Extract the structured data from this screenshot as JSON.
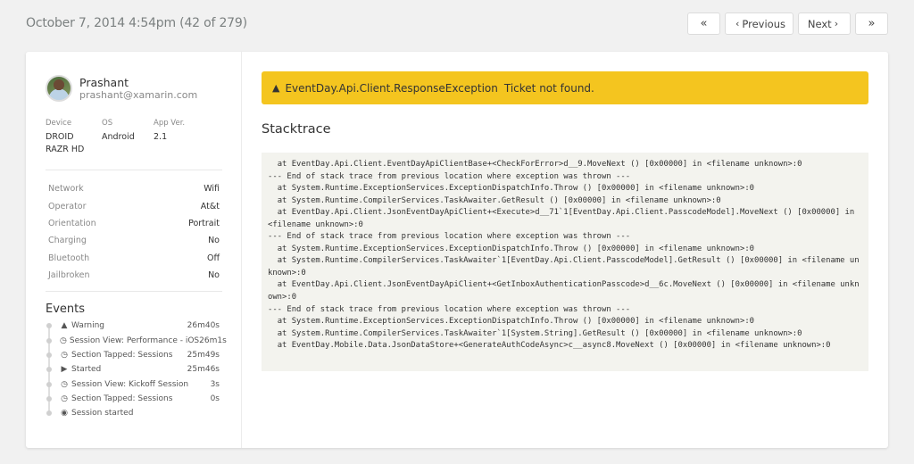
{
  "header": {
    "title": "October 7, 2014 4:54pm (42 of 279)"
  },
  "pager": {
    "first_icon": "«",
    "previous_label": "Previous",
    "previous_icon": "‹",
    "next_label": "Next",
    "next_icon": "›",
    "last_icon": "»"
  },
  "user": {
    "name": "Prashant",
    "email": "prashant@xamarin.com"
  },
  "device_meta": [
    {
      "label": "Device",
      "value": "DROID\nRAZR HD"
    },
    {
      "label": "OS",
      "value": "Android"
    },
    {
      "label": "App Ver.",
      "value": "2.1"
    }
  ],
  "properties": [
    {
      "key": "Network",
      "value": "Wifi"
    },
    {
      "key": "Operator",
      "value": "At&t"
    },
    {
      "key": "Orientation",
      "value": "Portrait"
    },
    {
      "key": "Charging",
      "value": "No"
    },
    {
      "key": "Bluetooth",
      "value": "Off"
    },
    {
      "key": "Jailbroken",
      "value": "No"
    }
  ],
  "events": {
    "title": "Events",
    "items": [
      {
        "icon": "warning-icon",
        "glyph": "▲",
        "label": "Warning",
        "time": "26m40s"
      },
      {
        "icon": "clock-icon",
        "glyph": "◷",
        "label": "Session View: Performance - iOS",
        "time": "26m1s"
      },
      {
        "icon": "clock-icon",
        "glyph": "◷",
        "label": "Section Tapped: Sessions",
        "time": "25m49s"
      },
      {
        "icon": "play-icon",
        "glyph": "▶",
        "label": "Started",
        "time": "25m46s"
      },
      {
        "icon": "clock-icon",
        "glyph": "◷",
        "label": "Session View: Kickoff Session",
        "time": "3s"
      },
      {
        "icon": "clock-icon",
        "glyph": "◷",
        "label": "Section Tapped: Sessions",
        "time": "0s"
      },
      {
        "icon": "play-circle-icon",
        "glyph": "◉",
        "label": "Session started",
        "time": ""
      }
    ]
  },
  "alert": {
    "icon": "▲",
    "exception": "EventDay.Api.Client.ResponseException",
    "message": "Ticket not found.",
    "color": "#f4c51f"
  },
  "stacktrace": {
    "title": "Stacktrace",
    "text": "  at EventDay.Api.Client.EventDayApiClientBase+<CheckForError>d__9.MoveNext () [0x00000] in <filename unknown>:0\n--- End of stack trace from previous location where exception was thrown ---\n  at System.Runtime.ExceptionServices.ExceptionDispatchInfo.Throw () [0x00000] in <filename unknown>:0\n  at System.Runtime.CompilerServices.TaskAwaiter.GetResult () [0x00000] in <filename unknown>:0\n  at EventDay.Api.Client.JsonEventDayApiClient+<Execute>d__71`1[EventDay.Api.Client.PasscodeModel].MoveNext () [0x00000] in <filename unknown>:0\n--- End of stack trace from previous location where exception was thrown ---\n  at System.Runtime.ExceptionServices.ExceptionDispatchInfo.Throw () [0x00000] in <filename unknown>:0\n  at System.Runtime.CompilerServices.TaskAwaiter`1[EventDay.Api.Client.PasscodeModel].GetResult () [0x00000] in <filename unknown>:0\n  at EventDay.Api.Client.JsonEventDayApiClient+<GetInboxAuthenticationPasscode>d__6c.MoveNext () [0x00000] in <filename unknown>:0\n--- End of stack trace from previous location where exception was thrown ---\n  at System.Runtime.ExceptionServices.ExceptionDispatchInfo.Throw () [0x00000] in <filename unknown>:0\n  at System.Runtime.CompilerServices.TaskAwaiter`1[System.String].GetResult () [0x00000] in <filename unknown>:0\n  at EventDay.Mobile.Data.JsonDataStore+<GenerateAuthCodeAsync>c__async8.MoveNext () [0x00000] in <filename unknown>:0"
  }
}
